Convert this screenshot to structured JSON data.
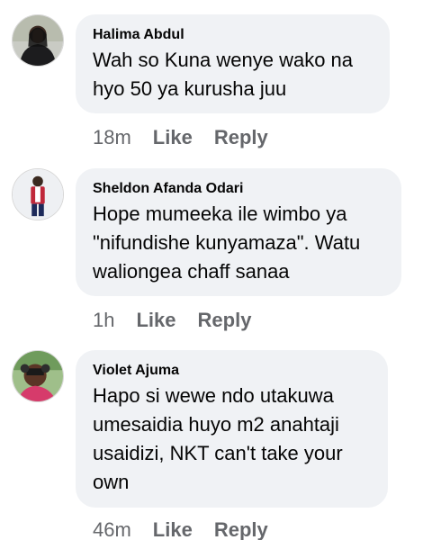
{
  "comments": [
    {
      "author": "Halima Abdul",
      "lines": [
        "Wah so Kuna wenye wako na",
        "hyo 50 ya kurusha juu"
      ],
      "time": "18m",
      "like_label": "Like",
      "reply_label": "Reply"
    },
    {
      "author": "Sheldon Afanda Odari",
      "lines": [
        "Hope mumeeka ile wimbo ya",
        "\"nifundishe kunyamaza\". Watu",
        "waliongea chaff sanaa"
      ],
      "time": "1h",
      "like_label": "Like",
      "reply_label": "Reply"
    },
    {
      "author": "Violet Ajuma",
      "lines": [
        "Hapo si wewe ndo utakuwa",
        "umesaidia huyo m2 anahtaji",
        "usaidizi, NKT can't take your",
        "own"
      ],
      "time": "46m",
      "like_label": "Like",
      "reply_label": "Reply"
    }
  ],
  "colors": {
    "bubble": "#f0f2f5",
    "text": "#050505",
    "meta": "#65676b"
  }
}
